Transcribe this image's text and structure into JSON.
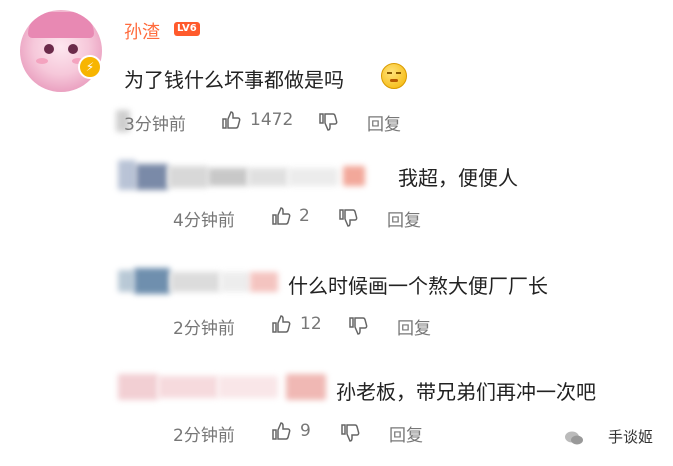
{
  "main_comment": {
    "username": "孙渣",
    "level_badge": "LV6",
    "text": "为了钱什么坏事都做是吗",
    "time": "3分钟前",
    "likes": "1472",
    "reply_label": "回复"
  },
  "replies": [
    {
      "text": "我超，便便人",
      "time": "4分钟前",
      "likes": "2",
      "reply_label": "回复"
    },
    {
      "text": "什么时候画一个熬大便厂厂长",
      "time": "2分钟前",
      "likes": "12",
      "reply_label": "回复"
    },
    {
      "text": "孙老板，带兄弟们再冲一次吧",
      "time": "2分钟前",
      "likes": "9",
      "reply_label": "回复"
    }
  ],
  "watermark": "手谈姬",
  "colors": {
    "username": "#ff6b3d",
    "level_badge": "#ff5a2c",
    "verified_badge": "#f7b500"
  }
}
